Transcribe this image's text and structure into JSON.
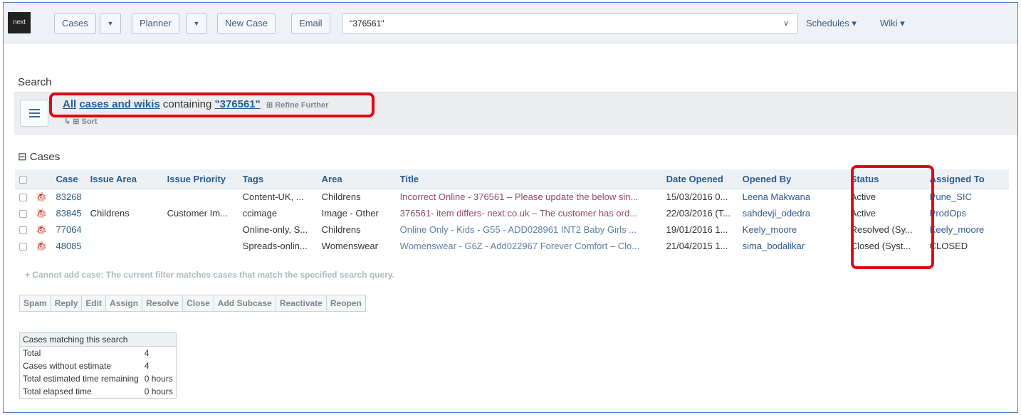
{
  "topbar": {
    "logo": "next",
    "cases": "Cases",
    "planner": "Planner",
    "new_case": "New Case",
    "email": "Email",
    "search_value": "\"376561\"",
    "schedules": "Schedules ▾",
    "wiki": "Wiki ▾"
  },
  "search": {
    "label": "Search",
    "criteria_all": "All",
    "criteria_scope": "cases and wikis",
    "criteria_containing": "containing",
    "criteria_query": "\"376561\"",
    "refine": "⊞ Refine Further",
    "sort": "↳ ⊞ Sort"
  },
  "cases": {
    "section_label": "⊟ Cases",
    "columns": [
      "Case",
      "Issue Area",
      "Issue Priority",
      "Tags",
      "Area",
      "Title",
      "Date Opened",
      "Opened By",
      "Status",
      "Assigned To"
    ],
    "rows": [
      {
        "case": "83268",
        "issue_area": "",
        "issue_priority": "",
        "tags": "Content-UK, ...",
        "area": "Childrens",
        "title": "Incorrect Online - 376561 – Please update the below sin...",
        "date_opened": "15/03/2016 0...",
        "opened_by": "Leena Makwana",
        "status": "Active",
        "assigned_to": "Pune_SIC"
      },
      {
        "case": "83845",
        "issue_area": "Childrens",
        "issue_priority": "Customer Im...",
        "tags": "ccimage",
        "area": "Image - Other",
        "title": "376561- item differs- next.co.uk – The customer has ord...",
        "date_opened": "22/03/2016 (T...",
        "opened_by": "sahdevji_odedra",
        "status": "Active",
        "assigned_to": "ProdOps"
      },
      {
        "case": "77064",
        "issue_area": "",
        "issue_priority": "",
        "tags": "Online-only, S...",
        "area": "Childrens",
        "title": "Online Only - Kids - G55 - ADD028961 INT2 Baby Girls ...",
        "date_opened": "19/01/2016 1...",
        "opened_by": "Keely_moore",
        "status": "Resolved (Sy...",
        "assigned_to": "Keely_moore"
      },
      {
        "case": "48085",
        "issue_area": "",
        "issue_priority": "",
        "tags": "Spreads-onlin...",
        "area": "Womenswear",
        "title": "Womenswear - G6Z - Add022967 Forever Comfort – Clo...",
        "date_opened": "21/04/2015 1...",
        "opened_by": "sima_bodalikar",
        "status": "Closed (Syst...",
        "assigned_to": "CLOSED"
      }
    ],
    "add_note": "+ Cannot add case: The current filter matches cases that match the specified search query."
  },
  "actions": [
    "Spam",
    "Reply",
    "Edit",
    "Assign",
    "Resolve",
    "Close",
    "Add Subcase",
    "Reactivate",
    "Reopen"
  ],
  "stats": {
    "header": "Cases matching this search",
    "rows": [
      {
        "label": "Total",
        "value": "4"
      },
      {
        "label": "Cases without estimate",
        "value": "4"
      },
      {
        "label": "Total estimated time remaining",
        "value": "0 hours"
      },
      {
        "label": "Total elapsed time",
        "value": "0 hours"
      }
    ]
  },
  "colors": {
    "highlight": "#e30613",
    "link": "#2a5b8f",
    "border": "#4a86c5"
  }
}
